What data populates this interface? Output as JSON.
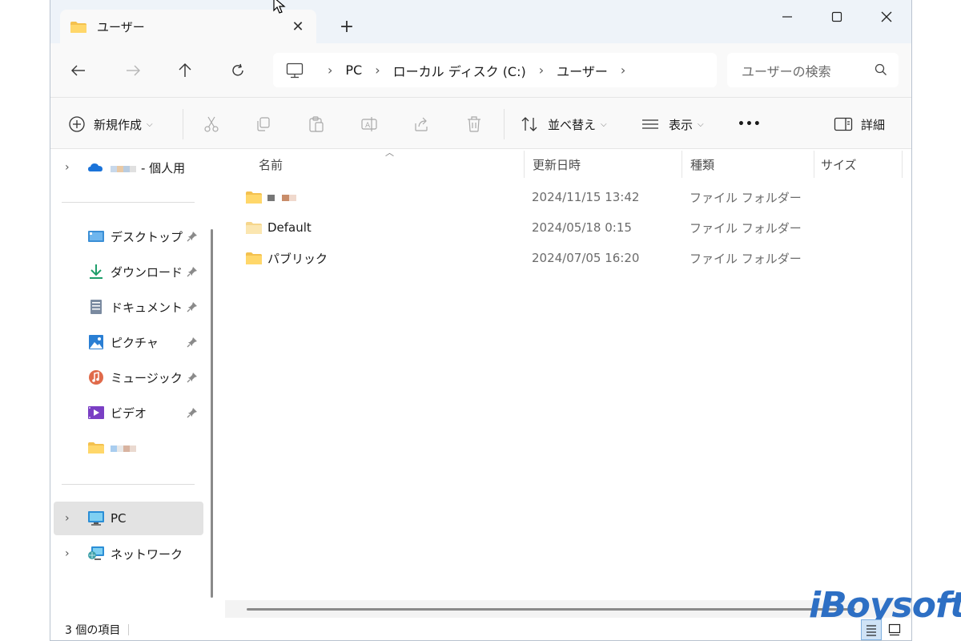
{
  "window": {
    "tab_title": "ユーザー",
    "close_tab_glyph": "✕",
    "new_tab_glyph": "+"
  },
  "address": {
    "crumbs": [
      "PC",
      "ローカル ディスク (C:)",
      "ユーザー"
    ],
    "search_placeholder": "ユーザーの検索"
  },
  "toolbar": {
    "new_label": "新規作成",
    "sort_label": "並べ替え",
    "view_label": "表示",
    "more_label": "•••",
    "details_label": "詳細"
  },
  "sidebar": {
    "onedrive_label": "- 個人用",
    "quick_access": [
      {
        "label": "デスクトップ",
        "icon": "desktop-icon"
      },
      {
        "label": "ダウンロード",
        "icon": "download-icon"
      },
      {
        "label": "ドキュメント",
        "icon": "document-icon"
      },
      {
        "label": "ピクチャ",
        "icon": "pictures-icon"
      },
      {
        "label": "ミュージック",
        "icon": "music-icon"
      },
      {
        "label": "ビデオ",
        "icon": "video-icon"
      }
    ],
    "pc_label": "PC",
    "network_label": "ネットワーク"
  },
  "columns": {
    "name": "名前",
    "modified": "更新日時",
    "type": "種類",
    "size": "サイズ"
  },
  "files": [
    {
      "name": "",
      "modified": "2024/11/15 13:42",
      "type": "ファイル フォルダー"
    },
    {
      "name": "Default",
      "modified": "2024/05/18 0:15",
      "type": "ファイル フォルダー"
    },
    {
      "name": "パブリック",
      "modified": "2024/07/05 16:20",
      "type": "ファイル フォルダー"
    }
  ],
  "status": {
    "item_count": "3 個の項目"
  },
  "watermark": "iBoysoft",
  "colors": {
    "accent": "#2d6fc4",
    "folder": "#f4c14f",
    "titlebar": "#eef3f9"
  }
}
